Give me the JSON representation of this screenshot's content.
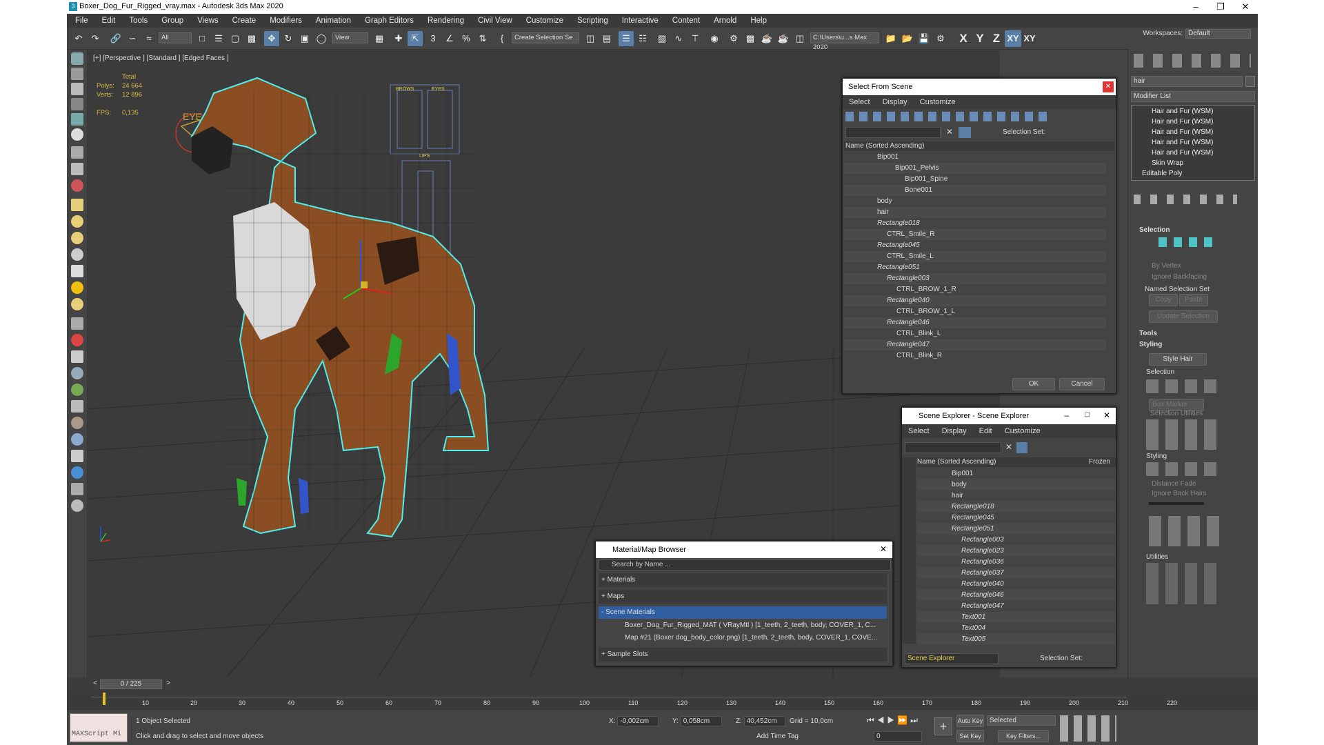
{
  "title": "Boxer_Dog_Fur_Rigged_vray.max - Autodesk 3ds Max 2020",
  "menu": [
    "File",
    "Edit",
    "Tools",
    "Group",
    "Views",
    "Create",
    "Modifiers",
    "Animation",
    "Graph Editors",
    "Rendering",
    "Civil View",
    "Customize",
    "Scripting",
    "Interactive",
    "Content",
    "Arnold",
    "Help"
  ],
  "workspace": {
    "label": "Workspaces:",
    "value": "Default"
  },
  "toolbar": {
    "filter": "All",
    "view": "View",
    "selection_set": "Create Selection Se",
    "path": "C:\\Users\\u...s Max 2020",
    "axes": [
      "X",
      "Y",
      "Z",
      "XY",
      "XY"
    ]
  },
  "viewport": {
    "label": "[+] [Perspective ] [Standard ] [Edged Faces ]",
    "stats_total": "Total",
    "polys_label": "Polys:",
    "polys": "24 664",
    "verts_label": "Verts:",
    "verts": "12 896",
    "fps_label": "FPS:",
    "fps": "0,135",
    "eye_label": "EYE",
    "brows_label": "BROWS",
    "eyes_label": "EYES",
    "lips_label": "LIPS"
  },
  "select_from_scene": {
    "title": "Select From Scene",
    "menu": [
      "Select",
      "Display",
      "Customize"
    ],
    "selection_set_label": "Selection Set:",
    "col_header": "Name (Sorted Ascending)",
    "rows": [
      "Bip001",
      "Bip001_Pelvis",
      "Bip001_Spine",
      "Bone001",
      "body",
      "hair",
      "Rectangle018",
      "CTRL_Smile_R",
      "Rectangle045",
      "CTRL_Smile_L",
      "Rectangle051",
      "Rectangle003",
      "CTRL_BROW_1_R",
      "Rectangle040",
      "CTRL_BROW_1_L",
      "Rectangle046",
      "CTRL_Blink_L",
      "Rectangle047",
      "CTRL_Blink_R"
    ],
    "ok": "OK",
    "cancel": "Cancel"
  },
  "scene_explorer": {
    "title": "Scene Explorer - Scene Explorer",
    "menu": [
      "Select",
      "Display",
      "Edit",
      "Customize"
    ],
    "col_header": "Name (Sorted Ascending)",
    "col_frozen": "Frozen",
    "rows": [
      "Bip001",
      "body",
      "hair",
      "Rectangle018",
      "Rectangle045",
      "Rectangle051",
      "Rectangle003",
      "Rectangle023",
      "Rectangle036",
      "Rectangle037",
      "Rectangle040",
      "Rectangle046",
      "Rectangle047",
      "Text001",
      "Text004",
      "Text005"
    ],
    "footer_name": "Scene Explorer",
    "footer_sel": "Selection Set:"
  },
  "material_browser": {
    "title": "Material/Map Browser",
    "search_placeholder": "Search by Name ...",
    "sections": [
      "+ Materials",
      "+ Maps",
      "- Scene Materials",
      "+ Sample Slots"
    ],
    "items": [
      "Boxer_Dog_Fur_Rigged_MAT  ( VRayMtl ) [1_teeth, 2_teeth, body, COVER_1, C...",
      "Map #21 (Boxer dog_body_color.png) [1_teeth, 2_teeth, body, COVER_1, COVE..."
    ]
  },
  "command_panel": {
    "search": "hair",
    "modifier_list": "Modifier List",
    "stack": [
      "Hair and Fur (WSM)",
      "Hair and Fur (WSM)",
      "Hair and Fur (WSM)",
      "Hair and Fur (WSM)",
      "Hair and Fur (WSM)",
      "Skin Wrap",
      "Editable Poly"
    ],
    "selection_title": "Selection",
    "by_vertex": "By Vertex",
    "ignore_backfacing": "Ignore Backfacing",
    "named_selection_set": "Named Selection Set",
    "copy": "Copy",
    "paste": "Paste",
    "update_selection": "Update Selection",
    "tools_title": "Tools",
    "styling_title": "Styling",
    "style_hair": "Style Hair",
    "selection_sub": "Selection",
    "box_marker": "Box Marker",
    "selection_utilities": "Selection Utilities",
    "styling_sub": "Styling",
    "distance_fade": "Distance Fade",
    "ignore_back_hairs": "Ignore Back Hairs",
    "utilities": "Utilities"
  },
  "timeline": {
    "frame": "0 / 225",
    "ticks": [
      "10",
      "20",
      "30",
      "40",
      "50",
      "60",
      "70",
      "80",
      "90",
      "100",
      "110",
      "120",
      "130",
      "140",
      "150",
      "160",
      "170",
      "180",
      "190",
      "200",
      "210",
      "220"
    ]
  },
  "status": {
    "maxscript": "MAXScript Mi",
    "selected": "1 Object Selected",
    "hint": "Click and drag to select and move objects",
    "x_label": "X:",
    "x": "-0,002cm",
    "y_label": "Y:",
    "y": "0,058cm",
    "z_label": "Z:",
    "z": "40,452cm",
    "grid": "Grid = 10,0cm",
    "add_time_tag": "Add Time Tag",
    "auto_key": "Auto Key",
    "set_key": "Set Key",
    "selected_dd": "Selected",
    "key_filters": "Key Filters...",
    "frame_field": "0"
  }
}
